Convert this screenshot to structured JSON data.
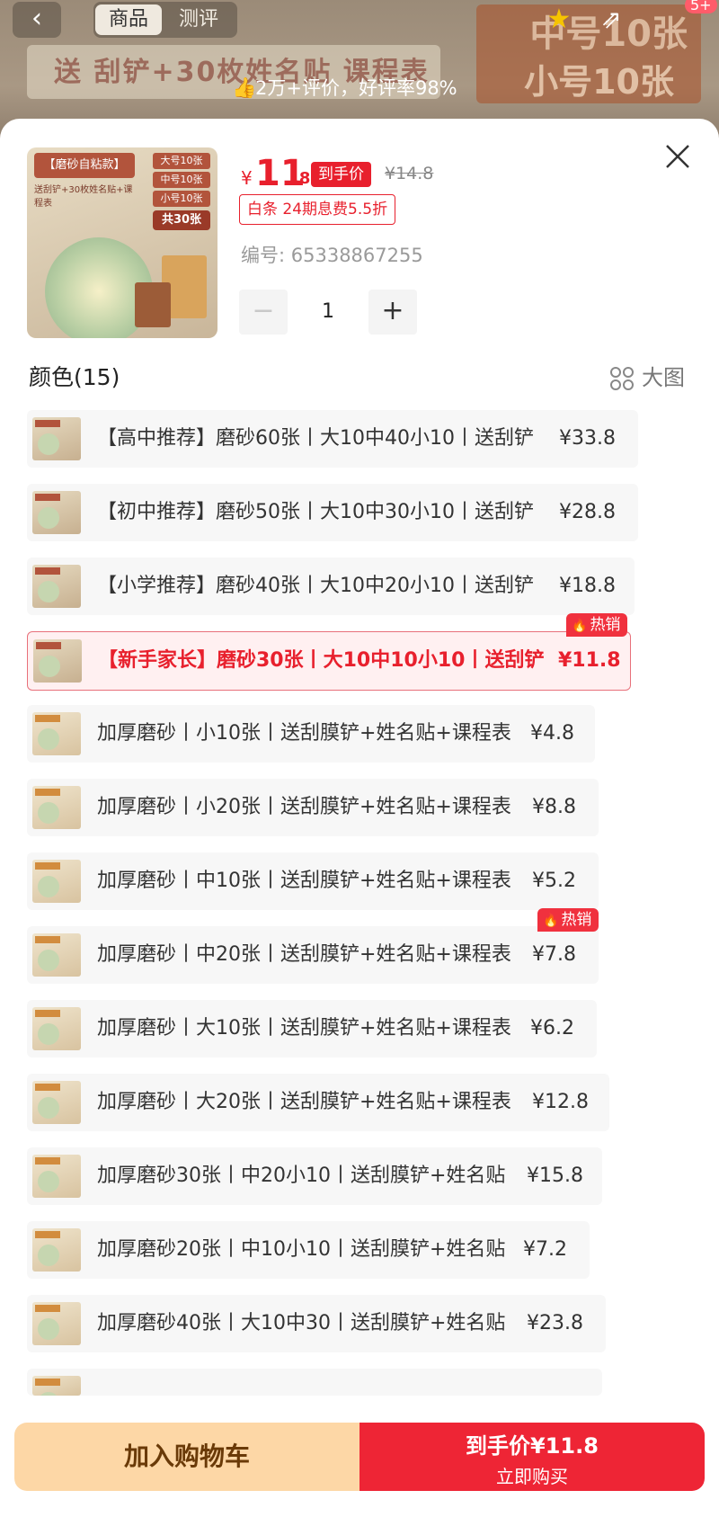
{
  "background": {
    "banner_text": "送 刮铲+30枚姓名贴 课程表",
    "right_text_1": "中号10张",
    "right_text_2": "小号10张",
    "tabs": [
      "商品",
      "测评"
    ],
    "review_text": "2万+评价，好评率98%",
    "more_badge": "5+",
    "back_icon": "‹"
  },
  "product": {
    "image": {
      "header": "【磨砂自粘款】",
      "sub": "送刮铲+30枚姓名贴+课程表",
      "sizes": [
        "大号10张",
        "中号10张",
        "小号10张"
      ],
      "total": "共30张"
    },
    "price_currency": "¥",
    "price_int": "11",
    "price_dec": ".8",
    "daoshou_label": "到手价",
    "original_price": "¥14.8",
    "baitiao": "白条 24期息费5.5折",
    "code": "编号: 65338867255",
    "quantity": "1",
    "minus": "−",
    "plus": "+"
  },
  "options_header": {
    "title": "颜色(15)",
    "big_view": "大图"
  },
  "options": [
    {
      "text": "【高中推荐】磨砂60张丨大10中40小10丨送刮铲",
      "price": "¥33.8"
    },
    {
      "text": "【初中推荐】磨砂50张丨大10中30小10丨送刮铲",
      "price": "¥28.8"
    },
    {
      "text": "【小学推荐】磨砂40张丨大10中20小10丨送刮铲",
      "price": "¥18.8"
    },
    {
      "text": "【新手家长】磨砂30张丨大10中10小10丨送刮铲",
      "price": "¥11.8",
      "badge": "热销"
    },
    {
      "text": "加厚磨砂丨小10张丨送刮膜铲+姓名贴+课程表",
      "price": "¥4.8"
    },
    {
      "text": "加厚磨砂丨小20张丨送刮膜铲+姓名贴+课程表",
      "price": "¥8.8"
    },
    {
      "text": "加厚磨砂丨中10张丨送刮膜铲+姓名贴+课程表",
      "price": "¥5.2"
    },
    {
      "text": "加厚磨砂丨中20张丨送刮膜铲+姓名贴+课程表",
      "price": "¥7.8",
      "badge": "热销"
    },
    {
      "text": "加厚磨砂丨大10张丨送刮膜铲+姓名贴+课程表",
      "price": "¥6.2"
    },
    {
      "text": "加厚磨砂丨大20张丨送刮膜铲+姓名贴+课程表",
      "price": "¥12.8"
    },
    {
      "text": "加厚磨砂30张丨中20小10丨送刮膜铲+姓名贴",
      "price": "¥15.8"
    },
    {
      "text": "加厚磨砂20张丨中10小10丨送刮膜铲+姓名贴",
      "price": "¥7.2"
    },
    {
      "text": "加厚磨砂40张丨大10中30丨送刮膜铲+姓名贴",
      "price": "¥23.8"
    }
  ],
  "bottom": {
    "cart": "加入购物车",
    "buy_line1": "到手价¥11.8",
    "buy_line2": "立即购买"
  },
  "colors": {
    "accent": "#e8202d",
    "cart_bg": "#fdd7a6",
    "buy_bg": "#ee2535"
  }
}
